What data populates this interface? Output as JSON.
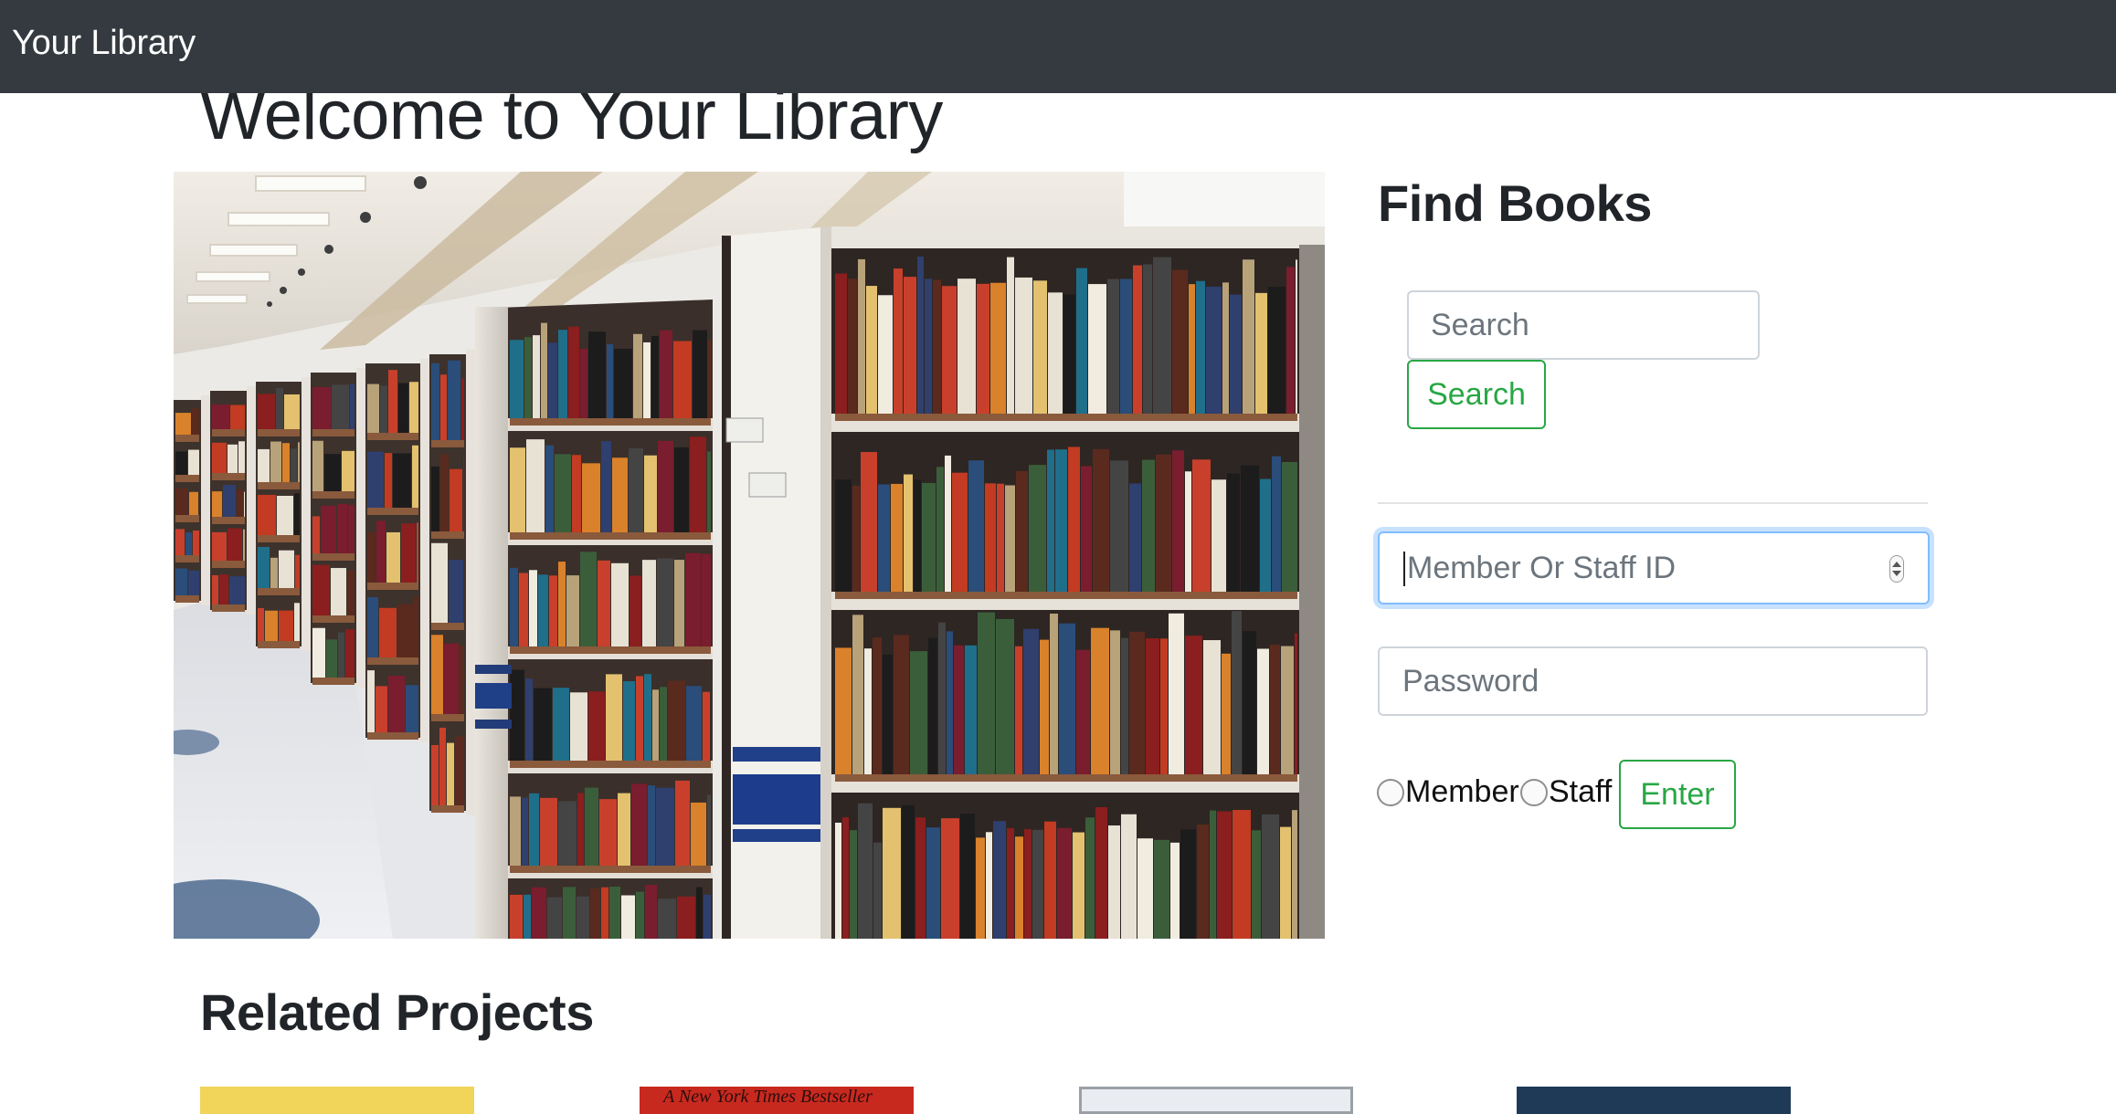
{
  "navbar": {
    "brand": "Your Library"
  },
  "page": {
    "heading": "Welcome to Your Library"
  },
  "hero": {
    "alt": "library bookshelves photo"
  },
  "find_books": {
    "title": "Find Books",
    "search_placeholder": "Search",
    "search_button": "Search"
  },
  "login": {
    "id_placeholder": "Member Or Staff ID",
    "password_placeholder": "Password",
    "radio_member": "Member",
    "radio_staff": "Staff",
    "enter_button": "Enter"
  },
  "related": {
    "title": "Related Projects",
    "thumbs": [
      {
        "color": "#f1d45a",
        "caption": ""
      },
      {
        "color": "#c8291f",
        "caption": "A New York Times Bestseller"
      },
      {
        "color": "#e9ecf1",
        "caption": ""
      },
      {
        "color": "#1e3a56",
        "caption": ""
      }
    ]
  },
  "colors": {
    "navbar_bg": "#343a40",
    "success": "#28a745",
    "focus_border": "#80bdff"
  }
}
